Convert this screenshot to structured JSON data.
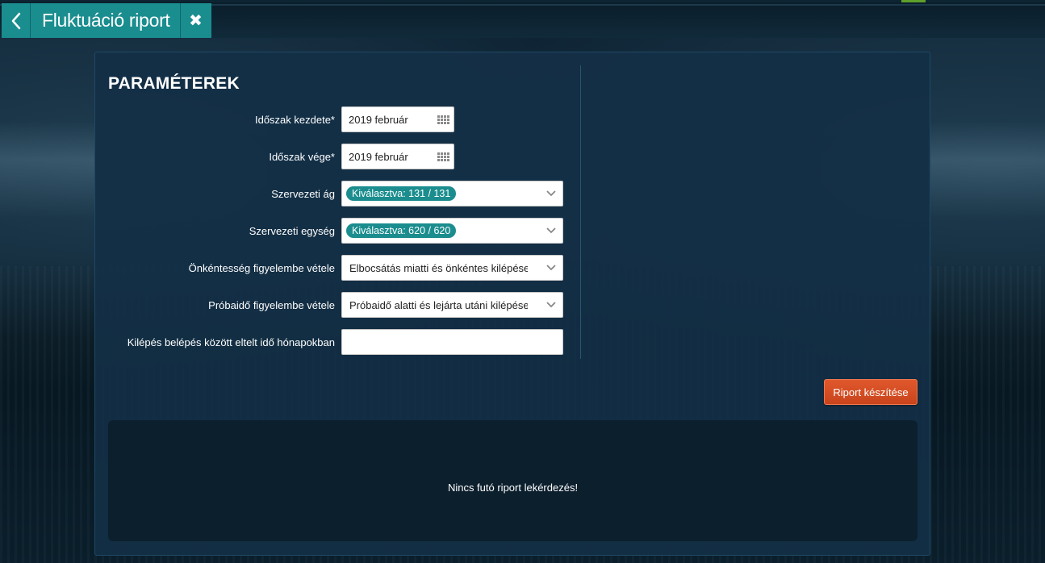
{
  "header": {
    "tab_title": "Fluktuáció riport",
    "back_icon": "chevron-left-icon",
    "close_icon": "close-icon",
    "close_glyph": "✖",
    "accent_color": "#1a8d8f"
  },
  "panel": {
    "section_title": "PARAMÉTEREK",
    "fields": {
      "period_start": {
        "label": "Időszak kezdete*",
        "value": "2019 február",
        "icon": "calendar-grid-icon"
      },
      "period_end": {
        "label": "Időszak vége*",
        "value": "2019 február",
        "icon": "calendar-grid-icon"
      },
      "org_branch": {
        "label": "Szervezeti ág",
        "chip": "Kiválasztva: 131 / 131"
      },
      "org_unit": {
        "label": "Szervezeti egység",
        "chip": "Kiválasztva: 620 / 620"
      },
      "voluntariness": {
        "label": "Önkéntesség figyelembe vétele",
        "value": "Elbocsátás miatti és önkéntes kilépése"
      },
      "probation": {
        "label": "Próbaidő figyelembe vétele",
        "value": "Próbaidő alatti és lejárta utáni kilépése"
      },
      "months_between": {
        "label": "Kilépés belépés között eltelt idő hónapokban",
        "value": ""
      }
    },
    "report_button": "Riport készítése",
    "status_message": "Nincs futó riport lekérdezés!",
    "button_color": "#d24e23",
    "chip_color": "#1b8d8e"
  }
}
